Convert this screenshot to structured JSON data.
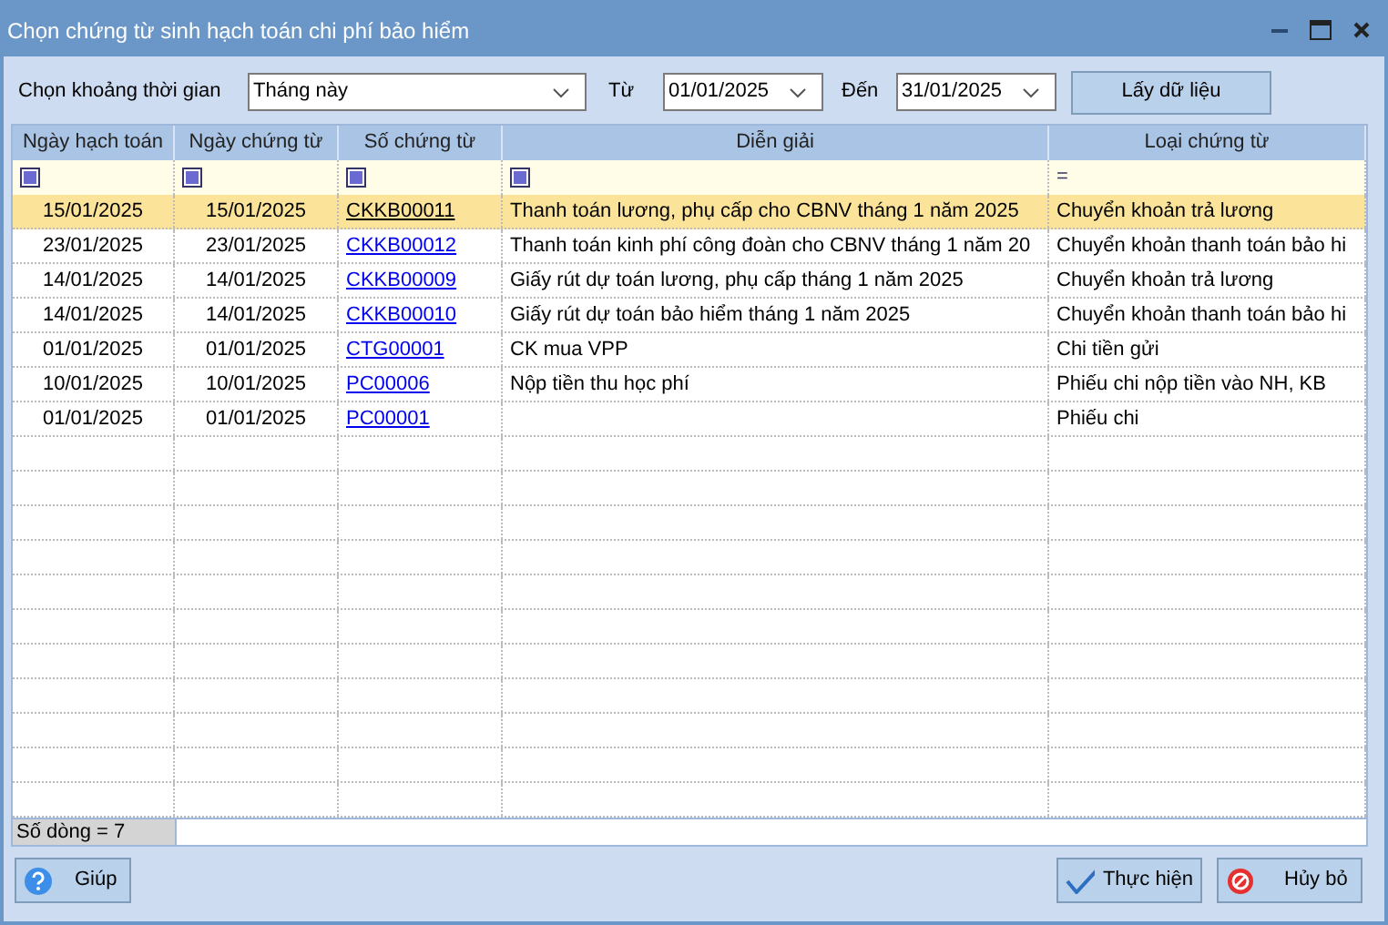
{
  "window": {
    "title": "Chọn chứng từ sinh hạch toán chi phí bảo hiểm"
  },
  "filter": {
    "period_label": "Chọn khoảng thời gian",
    "period": "Tháng này",
    "from_label": "Từ",
    "from": "01/01/2025",
    "to_label": "Đến",
    "to": "31/01/2025",
    "fetch_button": "Lấy dữ liệu"
  },
  "table": {
    "columns": [
      {
        "title": "Ngày hạch toán",
        "kind": "checkbox"
      },
      {
        "title": "Ngày chứng từ",
        "kind": "checkbox"
      },
      {
        "title": "Số chứng từ",
        "kind": "checkbox"
      },
      {
        "title": "Diễn giải",
        "kind": "checkbox"
      },
      {
        "title": "Loại chứng từ",
        "kind": "operator",
        "operator": "="
      }
    ],
    "rows": [
      {
        "selected": true,
        "cells": [
          "15/01/2025",
          "15/01/2025",
          "CKKB00011",
          "Thanh toán lương, phụ cấp cho CBNV tháng 1 năm 2025",
          "Chuyển khoản trả lương"
        ]
      },
      {
        "selected": false,
        "cells": [
          "23/01/2025",
          "23/01/2025",
          "CKKB00012",
          "Thanh toán kinh phí công đoàn cho CBNV tháng 1 năm 20",
          "Chuyển khoản thanh toán bảo hi"
        ]
      },
      {
        "selected": false,
        "cells": [
          "14/01/2025",
          "14/01/2025",
          "CKKB00009",
          "Giấy rút dự toán lương, phụ cấp tháng 1 năm 2025",
          "Chuyển khoản trả lương"
        ]
      },
      {
        "selected": false,
        "cells": [
          "14/01/2025",
          "14/01/2025",
          "CKKB00010",
          "Giấy rút dự toán bảo hiểm tháng 1 năm 2025",
          "Chuyển khoản thanh toán bảo hi"
        ]
      },
      {
        "selected": false,
        "cells": [
          "01/01/2025",
          "01/01/2025",
          "CTG00001",
          "CK mua VPP",
          "Chi tiền gửi"
        ]
      },
      {
        "selected": false,
        "cells": [
          "10/01/2025",
          "10/01/2025",
          "PC00006",
          "Nộp tiền thu học phí",
          "Phiếu chi nộp tiền vào NH, KB"
        ]
      },
      {
        "selected": false,
        "cells": [
          "01/01/2025",
          "01/01/2025",
          "PC00001",
          "",
          "Phiếu chi"
        ]
      }
    ],
    "footer": "Số dòng = 7"
  },
  "buttons": {
    "help": "Giúp",
    "ok": "Thực hiện",
    "cancel": "Hủy bỏ"
  }
}
